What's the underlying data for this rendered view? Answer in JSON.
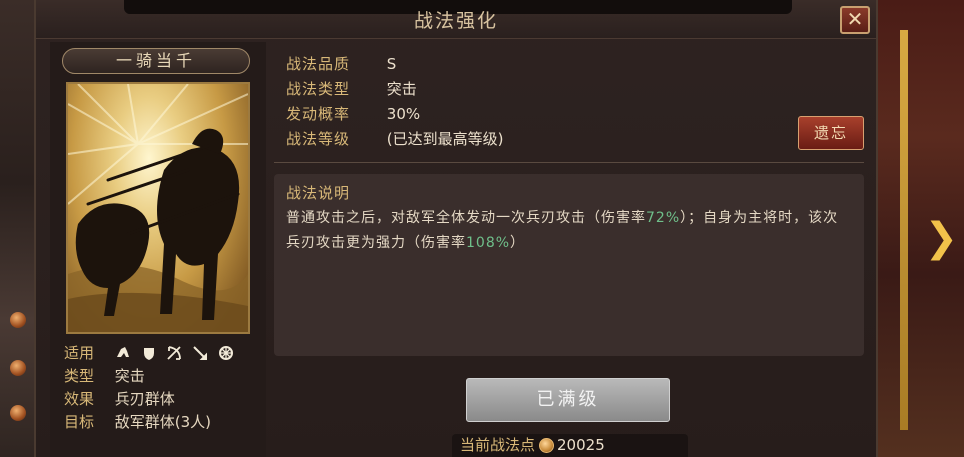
{
  "dialog": {
    "title": "战法强化",
    "close_label": "✕"
  },
  "card": {
    "name": "一骑当千",
    "attributes": [
      {
        "key": "适用",
        "value": ""
      },
      {
        "key": "类型",
        "value": "突击"
      },
      {
        "key": "效果",
        "value": "兵刃群体"
      },
      {
        "key": "目标",
        "value": "敌军群体(3人)"
      }
    ],
    "unit_icons": [
      "cavalry-icon",
      "shield-icon",
      "bow-icon",
      "spear-icon",
      "siege-icon"
    ]
  },
  "info": {
    "quality_label": "战法品质",
    "quality_value": "S",
    "type_label": "战法类型",
    "type_value": "突击",
    "chance_label": "发动概率",
    "chance_value": "30%",
    "level_label": "战法等级",
    "level_value": "(已达到最高等级)"
  },
  "forget_button": "遗忘",
  "description": {
    "title": "战法说明",
    "part1": "普通攻击之后，对敌军全体发动一次兵刃攻击（伤害率",
    "rate1": "72%",
    "part2": "）；自身为主将时，该次兵刃攻击更为强力（伤害率",
    "rate2": "108%",
    "part3": "）"
  },
  "maxed_button": "已满级",
  "points": {
    "label": "当前战法点",
    "value": "20025"
  },
  "colors": {
    "accent_gold": "#d8b878",
    "highlight_green": "#6fbf8a",
    "button_red": "#a8402c"
  }
}
